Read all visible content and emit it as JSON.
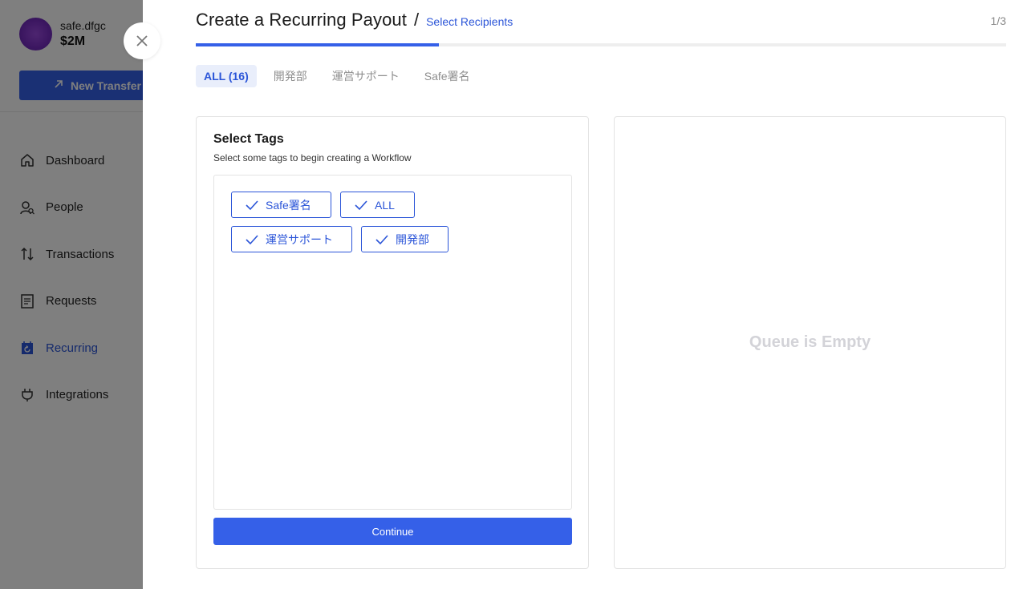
{
  "account": {
    "name": "safe.dfgc",
    "balance": "$2M"
  },
  "sidebar": {
    "new_transfer_label": "New Transfer",
    "items": [
      {
        "label": "Dashboard",
        "icon": "home-icon"
      },
      {
        "label": "People",
        "icon": "people-icon"
      },
      {
        "label": "Transactions",
        "icon": "transactions-icon"
      },
      {
        "label": "Requests",
        "icon": "requests-icon"
      },
      {
        "label": "Recurring",
        "icon": "calendar-recurring-icon",
        "active": true
      },
      {
        "label": "Integrations",
        "icon": "plug-icon"
      }
    ]
  },
  "modal": {
    "title": "Create a Recurring Payout",
    "separator": "/",
    "breadcrumb": "Select Recipients",
    "step": "1/3",
    "progress": 0.3,
    "tabs": [
      "ALL (16)",
      "開発部",
      "運営サポート",
      "Safe署名"
    ],
    "active_tab": 0
  },
  "select_tags": {
    "title": "Select Tags",
    "subtitle": "Select some tags to begin creating a Workflow",
    "tags_row1": [
      "Safe署名",
      "ALL"
    ],
    "tags_row2": [
      "運営サポート",
      "開発部"
    ],
    "continue_label": "Continue"
  },
  "queue": {
    "empty_text": "Queue is Empty"
  },
  "colors": {
    "accent": "#3560e8",
    "link": "#2b55d8",
    "overlay": "rgba(0,0,0,0.5)"
  }
}
